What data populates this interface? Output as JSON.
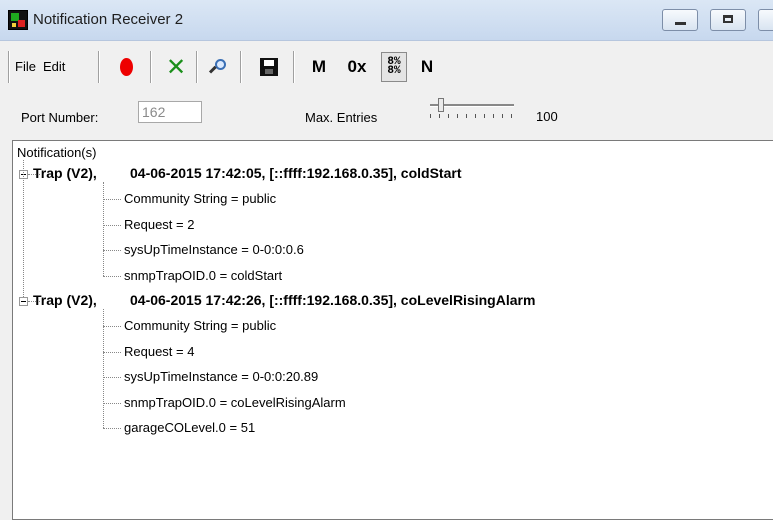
{
  "window": {
    "title": "Notification Receiver 2"
  },
  "toolbar": {
    "menu_file": "File",
    "menu_edit": "Edit",
    "btn_m": "M",
    "btn_hex": "0x",
    "btn_bits": "8%\n8%",
    "btn_n": "N"
  },
  "settings": {
    "port_label": "Port Number:",
    "port_value": "162",
    "entries_label": "Max. Entries",
    "entries_value": "100",
    "entries_slider_level": 0.1
  },
  "tree": {
    "root_label": "Notification(s)",
    "traps": [
      {
        "type": "Trap (V2),",
        "header": "04-06-2015 17:42:05, [::ffff:192.168.0.35], coldStart",
        "fields": [
          "Community String = public",
          "Request = 2",
          "sysUpTimeInstance = 0-0:0:0.6",
          "snmpTrapOID.0 = coldStart"
        ]
      },
      {
        "type": "Trap (V2),",
        "header": "04-06-2015 17:42:26, [::ffff:192.168.0.35], coLevelRisingAlarm",
        "fields": [
          "Community String = public",
          "Request = 4",
          "sysUpTimeInstance = 0-0:0:20.89",
          "snmpTrapOID.0 = coLevelRisingAlarm",
          "garageCOLevel.0 = 51"
        ]
      }
    ]
  }
}
